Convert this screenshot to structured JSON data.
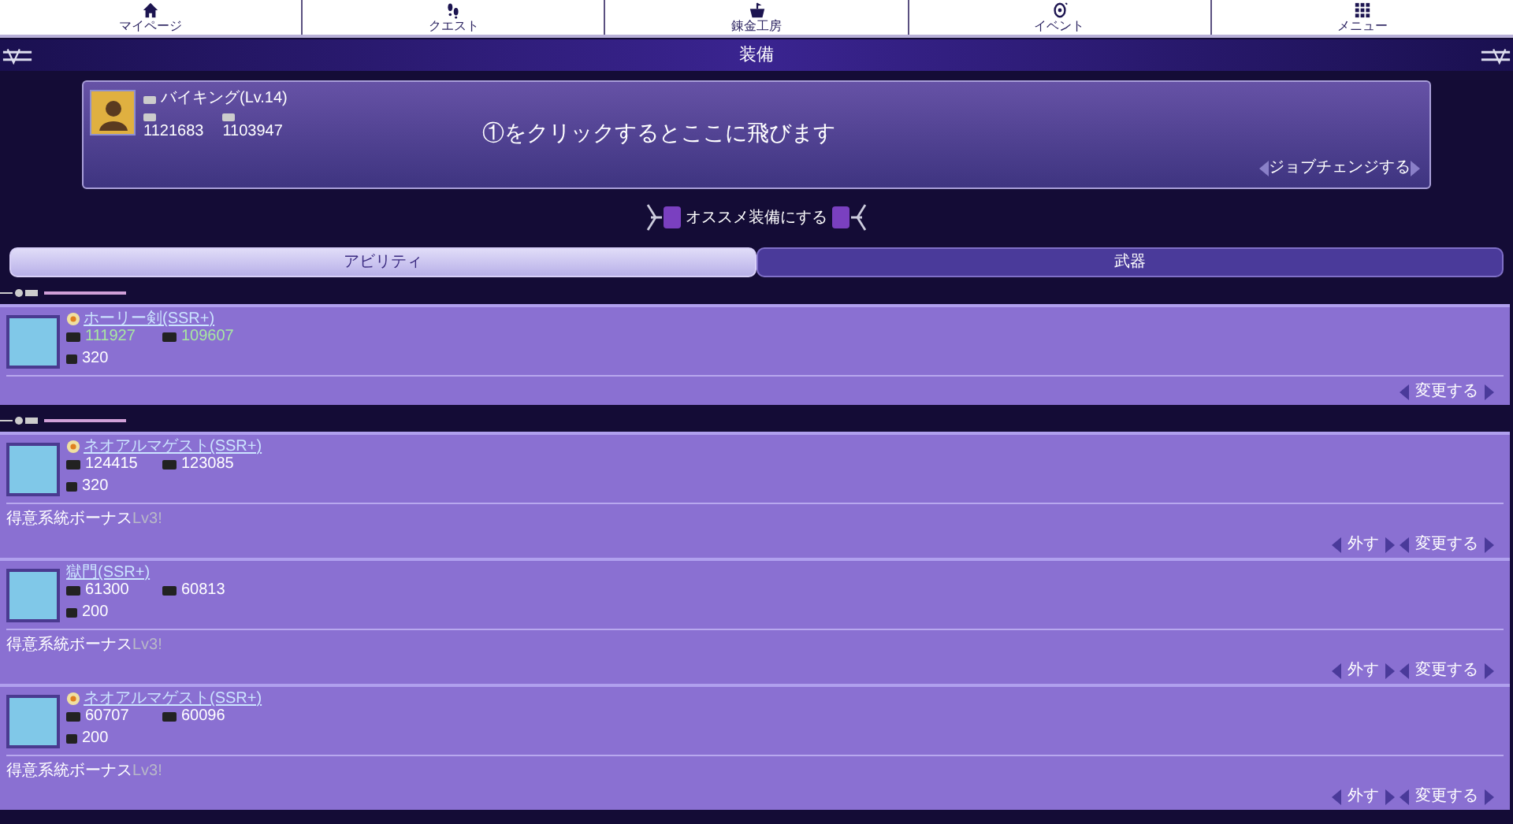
{
  "nav": [
    {
      "kind": "home",
      "label": "マイページ"
    },
    {
      "kind": "quest",
      "label": "クエスト"
    },
    {
      "kind": "pot",
      "label": "錬金工房"
    },
    {
      "kind": "event",
      "label": "イベント"
    },
    {
      "kind": "menu",
      "label": "メニュー"
    }
  ],
  "title": "装備",
  "profile": {
    "name": "バイキング(Lv.14)",
    "atk": "1121683",
    "def": "1103947",
    "notice": "①をクリックするとここに飛びます",
    "button": "ジョブチェンジする"
  },
  "recommend_button": "オススメ装備にする",
  "tabs": [
    {
      "label": "アビリティ",
      "selected": true
    },
    {
      "label": "武器",
      "selected": false
    }
  ],
  "sections": [
    {
      "items": [
        {
          "name": "ホーリー剣(SSR+)",
          "rarity_icon": true,
          "highlighted": true,
          "atk": "111927",
          "def": "109607",
          "level": "320",
          "buttons": [
            "変更する"
          ]
        }
      ]
    },
    {
      "items": [
        {
          "name": "ネオアルマゲスト(SSR+)",
          "rarity_icon": true,
          "highlighted": false,
          "atk": "124415",
          "def": "123085",
          "level": "320",
          "bonus": "得意系統ボーナス",
          "bonus_level": "Lv3!",
          "buttons": [
            "外す",
            "変更する"
          ]
        },
        {
          "name": "獄門(SSR+)",
          "rarity_icon": false,
          "highlighted": false,
          "atk": "61300",
          "def": "60813",
          "level": "200",
          "bonus": "得意系統ボーナス",
          "bonus_level": "Lv3!",
          "buttons": [
            "外す",
            "変更する"
          ]
        },
        {
          "name": "ネオアルマゲスト(SSR+)",
          "rarity_icon": true,
          "highlighted": false,
          "atk": "60707",
          "def": "60096",
          "level": "200",
          "bonus": "得意系統ボーナス",
          "bonus_level": "Lv3!",
          "buttons": [
            "外す",
            "変更する"
          ]
        }
      ]
    }
  ]
}
